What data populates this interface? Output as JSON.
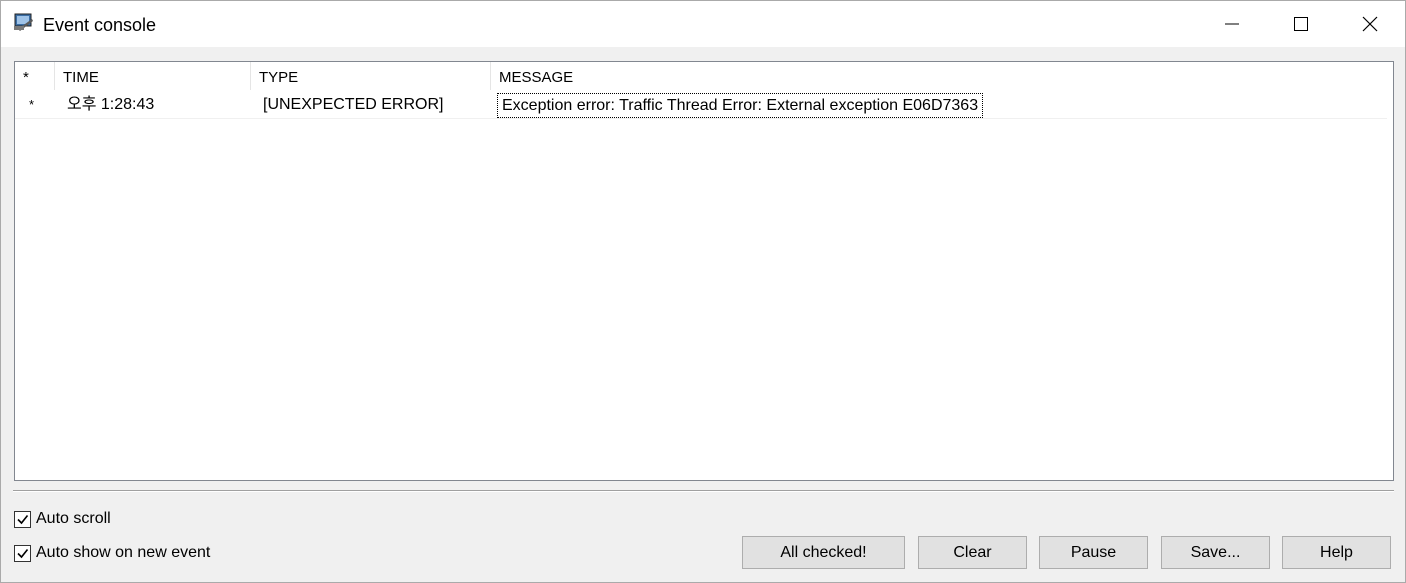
{
  "window": {
    "title": "Event console",
    "icon": "monitor-app-icon"
  },
  "table": {
    "columns": [
      "*",
      "TIME",
      "TYPE",
      "MESSAGE"
    ],
    "rows": [
      {
        "marker": "*",
        "time": "오후 1:28:43",
        "type": "[UNEXPECTED ERROR]",
        "message": "Exception error: Traffic Thread Error: External exception E06D7363"
      }
    ]
  },
  "options": {
    "auto_scroll": {
      "label": "Auto scroll",
      "checked": true
    },
    "auto_show": {
      "label": "Auto show on new event",
      "checked": true
    }
  },
  "buttons": {
    "all_checked": "All checked!",
    "clear": "Clear",
    "pause": "Pause",
    "save": "Save...",
    "help": "Help"
  }
}
